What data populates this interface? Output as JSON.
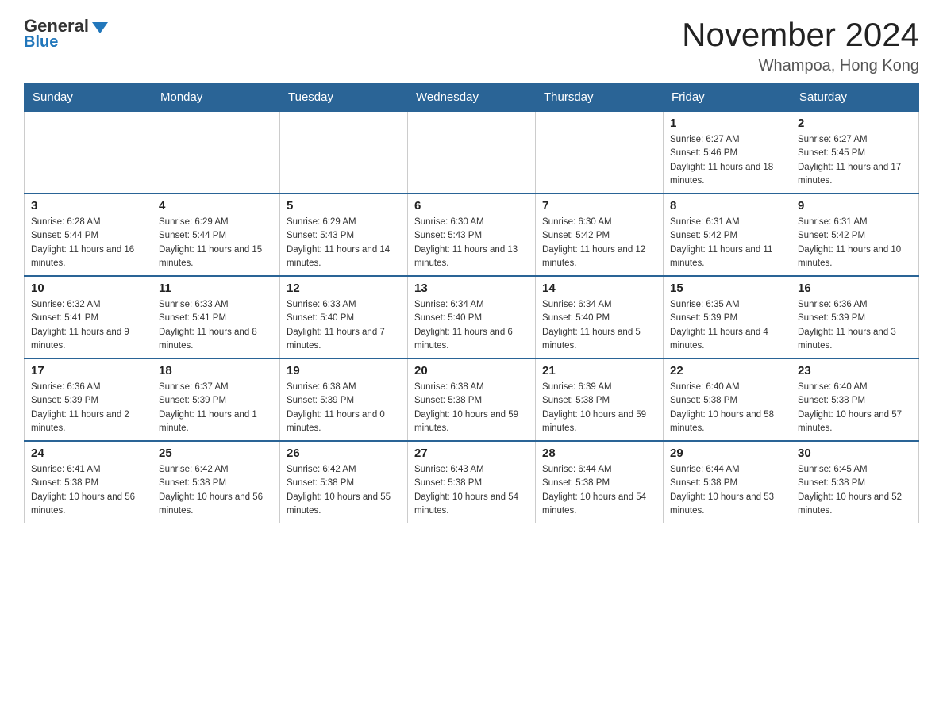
{
  "header": {
    "logo_general": "General",
    "logo_blue": "Blue",
    "title": "November 2024",
    "subtitle": "Whampoa, Hong Kong"
  },
  "days_of_week": [
    "Sunday",
    "Monday",
    "Tuesday",
    "Wednesday",
    "Thursday",
    "Friday",
    "Saturday"
  ],
  "weeks": [
    [
      {
        "day": "",
        "info": ""
      },
      {
        "day": "",
        "info": ""
      },
      {
        "day": "",
        "info": ""
      },
      {
        "day": "",
        "info": ""
      },
      {
        "day": "",
        "info": ""
      },
      {
        "day": "1",
        "info": "Sunrise: 6:27 AM\nSunset: 5:46 PM\nDaylight: 11 hours and 18 minutes."
      },
      {
        "day": "2",
        "info": "Sunrise: 6:27 AM\nSunset: 5:45 PM\nDaylight: 11 hours and 17 minutes."
      }
    ],
    [
      {
        "day": "3",
        "info": "Sunrise: 6:28 AM\nSunset: 5:44 PM\nDaylight: 11 hours and 16 minutes."
      },
      {
        "day": "4",
        "info": "Sunrise: 6:29 AM\nSunset: 5:44 PM\nDaylight: 11 hours and 15 minutes."
      },
      {
        "day": "5",
        "info": "Sunrise: 6:29 AM\nSunset: 5:43 PM\nDaylight: 11 hours and 14 minutes."
      },
      {
        "day": "6",
        "info": "Sunrise: 6:30 AM\nSunset: 5:43 PM\nDaylight: 11 hours and 13 minutes."
      },
      {
        "day": "7",
        "info": "Sunrise: 6:30 AM\nSunset: 5:42 PM\nDaylight: 11 hours and 12 minutes."
      },
      {
        "day": "8",
        "info": "Sunrise: 6:31 AM\nSunset: 5:42 PM\nDaylight: 11 hours and 11 minutes."
      },
      {
        "day": "9",
        "info": "Sunrise: 6:31 AM\nSunset: 5:42 PM\nDaylight: 11 hours and 10 minutes."
      }
    ],
    [
      {
        "day": "10",
        "info": "Sunrise: 6:32 AM\nSunset: 5:41 PM\nDaylight: 11 hours and 9 minutes."
      },
      {
        "day": "11",
        "info": "Sunrise: 6:33 AM\nSunset: 5:41 PM\nDaylight: 11 hours and 8 minutes."
      },
      {
        "day": "12",
        "info": "Sunrise: 6:33 AM\nSunset: 5:40 PM\nDaylight: 11 hours and 7 minutes."
      },
      {
        "day": "13",
        "info": "Sunrise: 6:34 AM\nSunset: 5:40 PM\nDaylight: 11 hours and 6 minutes."
      },
      {
        "day": "14",
        "info": "Sunrise: 6:34 AM\nSunset: 5:40 PM\nDaylight: 11 hours and 5 minutes."
      },
      {
        "day": "15",
        "info": "Sunrise: 6:35 AM\nSunset: 5:39 PM\nDaylight: 11 hours and 4 minutes."
      },
      {
        "day": "16",
        "info": "Sunrise: 6:36 AM\nSunset: 5:39 PM\nDaylight: 11 hours and 3 minutes."
      }
    ],
    [
      {
        "day": "17",
        "info": "Sunrise: 6:36 AM\nSunset: 5:39 PM\nDaylight: 11 hours and 2 minutes."
      },
      {
        "day": "18",
        "info": "Sunrise: 6:37 AM\nSunset: 5:39 PM\nDaylight: 11 hours and 1 minute."
      },
      {
        "day": "19",
        "info": "Sunrise: 6:38 AM\nSunset: 5:39 PM\nDaylight: 11 hours and 0 minutes."
      },
      {
        "day": "20",
        "info": "Sunrise: 6:38 AM\nSunset: 5:38 PM\nDaylight: 10 hours and 59 minutes."
      },
      {
        "day": "21",
        "info": "Sunrise: 6:39 AM\nSunset: 5:38 PM\nDaylight: 10 hours and 59 minutes."
      },
      {
        "day": "22",
        "info": "Sunrise: 6:40 AM\nSunset: 5:38 PM\nDaylight: 10 hours and 58 minutes."
      },
      {
        "day": "23",
        "info": "Sunrise: 6:40 AM\nSunset: 5:38 PM\nDaylight: 10 hours and 57 minutes."
      }
    ],
    [
      {
        "day": "24",
        "info": "Sunrise: 6:41 AM\nSunset: 5:38 PM\nDaylight: 10 hours and 56 minutes."
      },
      {
        "day": "25",
        "info": "Sunrise: 6:42 AM\nSunset: 5:38 PM\nDaylight: 10 hours and 56 minutes."
      },
      {
        "day": "26",
        "info": "Sunrise: 6:42 AM\nSunset: 5:38 PM\nDaylight: 10 hours and 55 minutes."
      },
      {
        "day": "27",
        "info": "Sunrise: 6:43 AM\nSunset: 5:38 PM\nDaylight: 10 hours and 54 minutes."
      },
      {
        "day": "28",
        "info": "Sunrise: 6:44 AM\nSunset: 5:38 PM\nDaylight: 10 hours and 54 minutes."
      },
      {
        "day": "29",
        "info": "Sunrise: 6:44 AM\nSunset: 5:38 PM\nDaylight: 10 hours and 53 minutes."
      },
      {
        "day": "30",
        "info": "Sunrise: 6:45 AM\nSunset: 5:38 PM\nDaylight: 10 hours and 52 minutes."
      }
    ]
  ]
}
